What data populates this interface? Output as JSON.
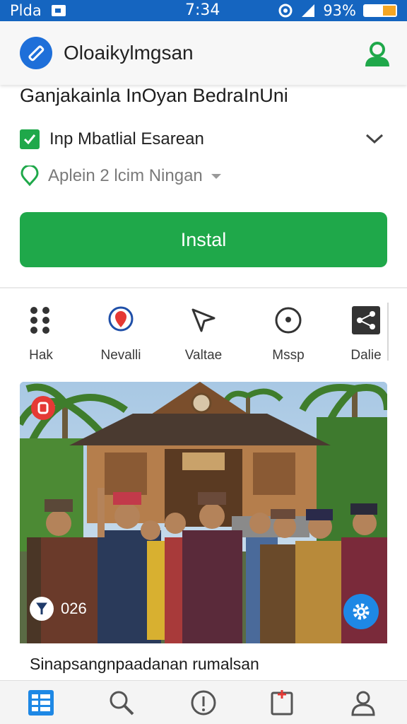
{
  "status_bar": {
    "carrier": "Plda",
    "time": "7:34",
    "battery_pct": "93%",
    "icons": [
      "image-icon",
      "sync-icon",
      "signal-icon",
      "battery-icon"
    ]
  },
  "app_bar": {
    "title": "Oloaikylmgsan",
    "icons": [
      "app-logo-icon",
      "profile-icon"
    ]
  },
  "heading": "Ganjakainla InOyan BedraInUni",
  "options": {
    "row1_label": "Inp Mbatlial Esarean",
    "row2_label": "Aplein 2 lcim Ningan"
  },
  "install_label": "Instal",
  "tabs": [
    {
      "label": "Hak",
      "icon": "grid-dots-icon"
    },
    {
      "label": "Nevalli",
      "icon": "location-pin-icon"
    },
    {
      "label": "Valtae",
      "icon": "compass-icon"
    },
    {
      "label": "Mssp",
      "icon": "map-circle-icon"
    },
    {
      "label": "Dalie",
      "icon": "share-icon"
    }
  ],
  "card": {
    "views": "026",
    "caption": "Sinapsangnpaadanan rumalsan",
    "icons": [
      "badge-icon",
      "pin-icon",
      "gear-icon"
    ]
  },
  "bottom_nav": [
    "home-grid-icon",
    "search-icon",
    "info-icon",
    "bookmark-icon",
    "user-icon"
  ],
  "colors": {
    "status_bar": "#1565c0",
    "accent_green": "#1fa84a",
    "logo_blue": "#1e6fd9",
    "nav_active": "#1e88e5"
  }
}
